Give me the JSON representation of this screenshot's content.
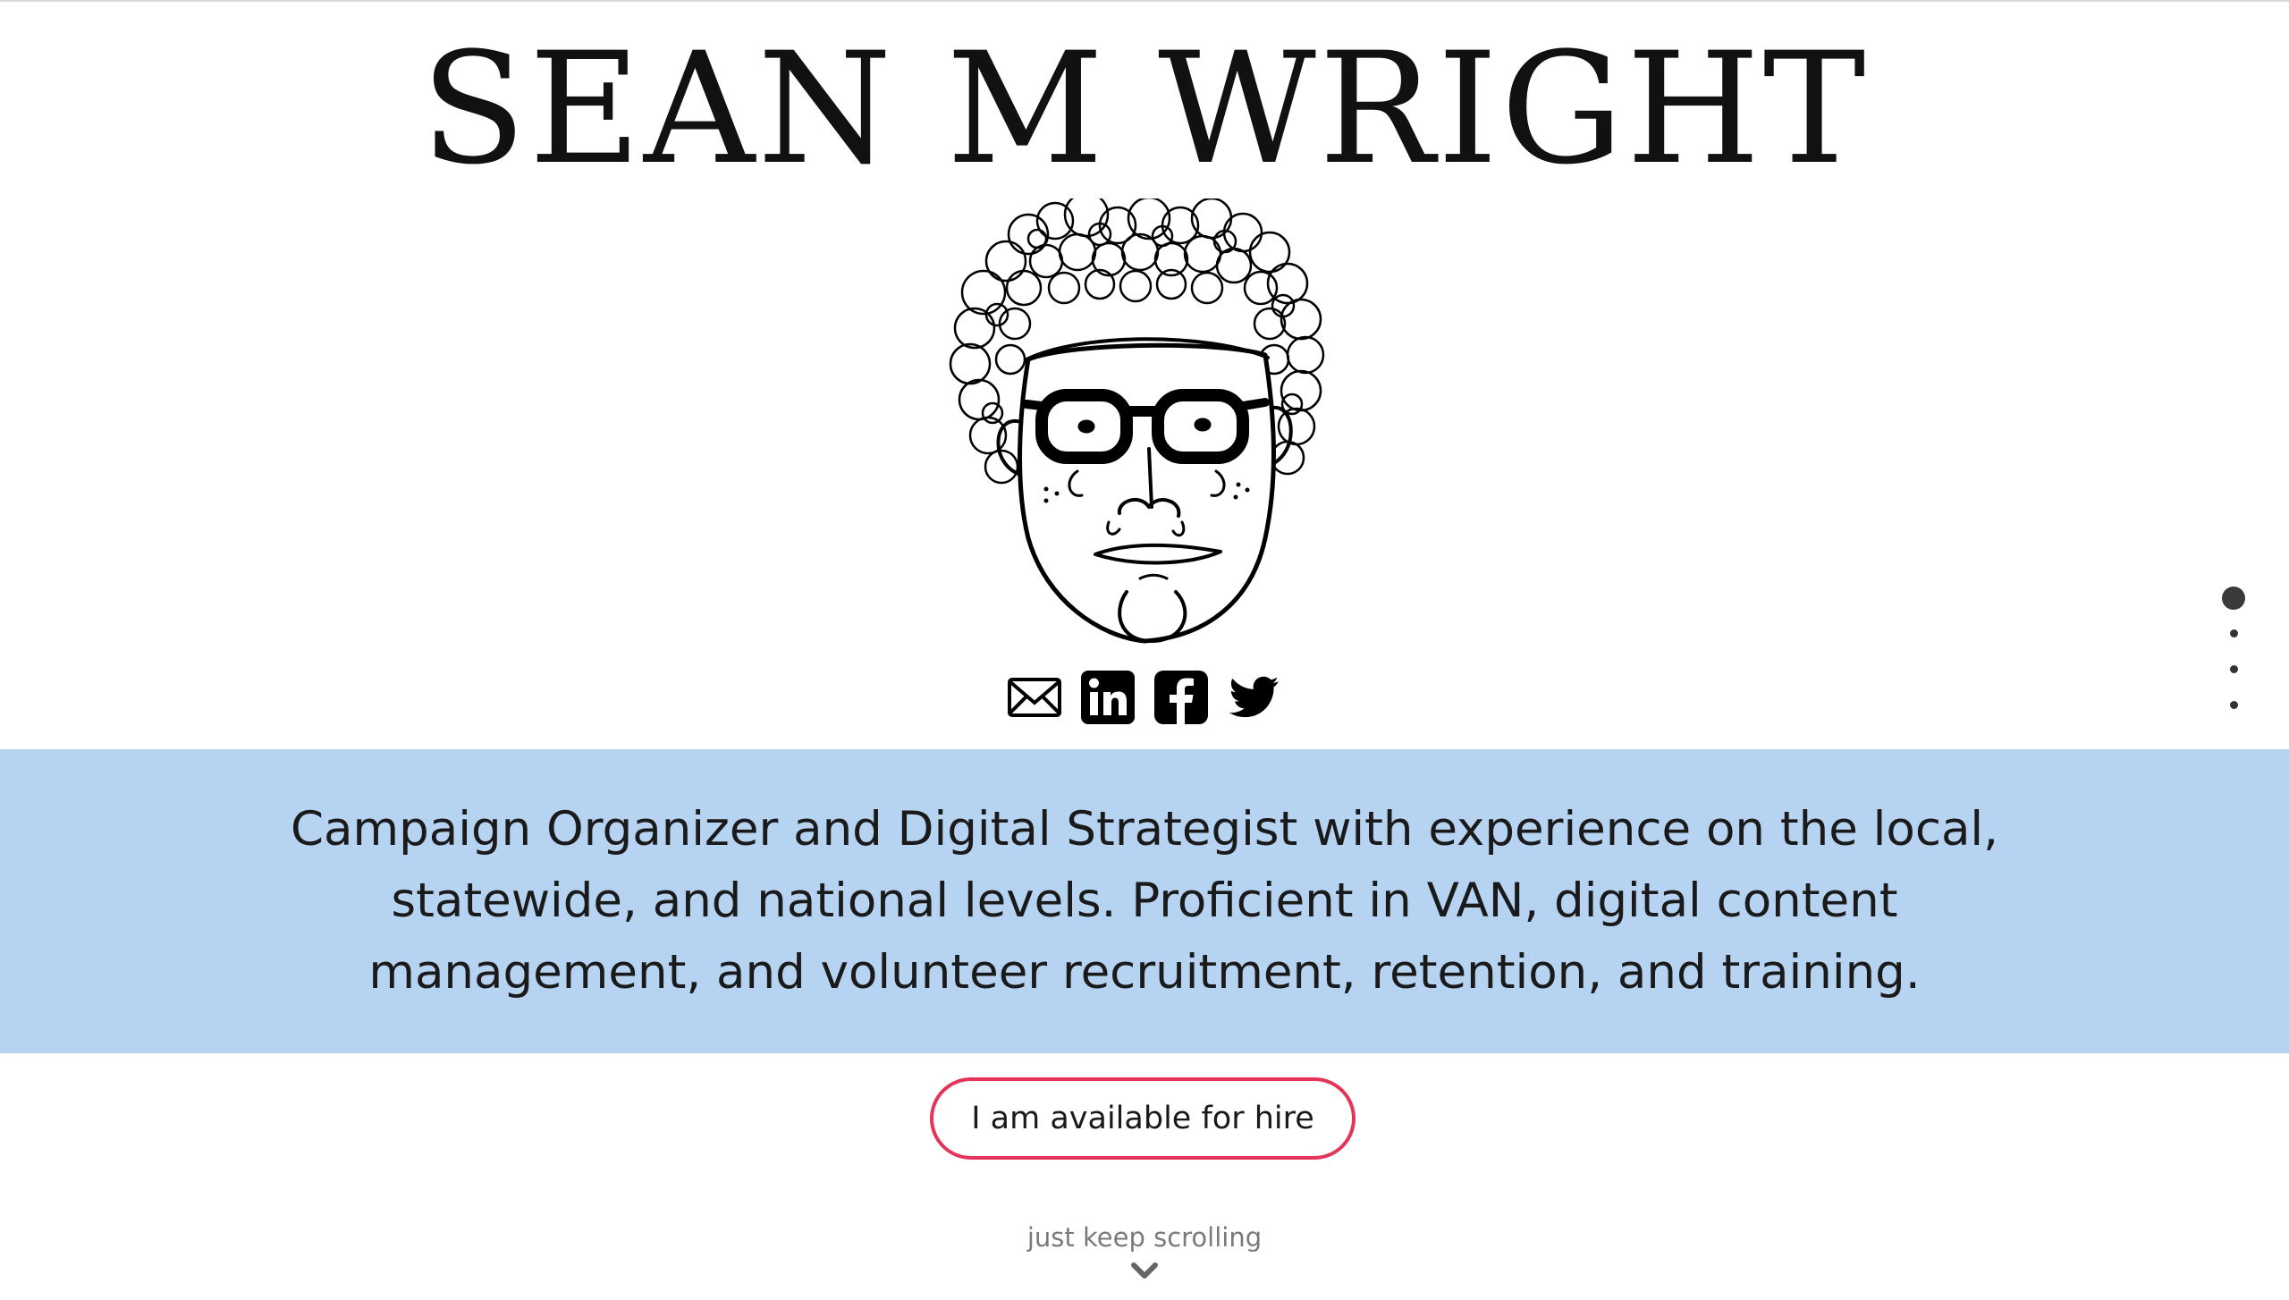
{
  "header": {
    "site_title": "SEAN M WRIGHT"
  },
  "avatar": {
    "icon": "caricature-portrait"
  },
  "social": {
    "items": [
      {
        "icon": "mail-icon"
      },
      {
        "icon": "linkedin-icon"
      },
      {
        "icon": "facebook-icon"
      },
      {
        "icon": "twitter-icon"
      }
    ]
  },
  "intro": {
    "tagline": "Campaign Organizer and Digital Strategist with experience on the local, statewide, and national levels. Proficient in VAN, digital content management, and volunteer recruitment, retention, and training.",
    "band_color": "#b7d3f2"
  },
  "cta": {
    "hire_label": "I am available for hire",
    "border_color": "#e5345a"
  },
  "scroll": {
    "hint": "just keep scrolling",
    "icon": "chevron-down-icon"
  },
  "section_nav": {
    "count": 4,
    "active_index": 0
  }
}
